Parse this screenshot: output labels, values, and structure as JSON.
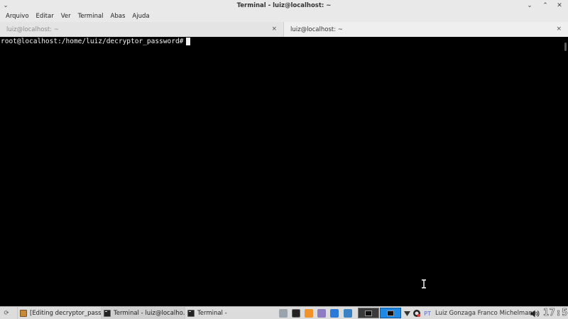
{
  "window": {
    "title": "Terminal - luiz@localhost: ~"
  },
  "menubar": {
    "items": [
      "Arquivo",
      "Editar",
      "Ver",
      "Terminal",
      "Abas",
      "Ajuda"
    ]
  },
  "tabs": [
    {
      "label": "luiz@localhost: ~",
      "active": false
    },
    {
      "label": "luiz@localhost: ~",
      "active": true
    }
  ],
  "terminal": {
    "prompt": "root@localhost:/home/luiz/decryptor_password#"
  },
  "taskbar": {
    "tasks": [
      {
        "label": "[Editing decryptor_pass...",
        "icon": "text-editor-icon"
      },
      {
        "label": "Terminal - luiz@localho...",
        "icon": "terminal-icon"
      },
      {
        "label": "Terminal -",
        "icon": "terminal-icon"
      }
    ],
    "language": "PT",
    "user": "Luiz Gonzaga Franco Michelmann",
    "clock": "17:50"
  },
  "colors": {
    "workspace_active": "#1e88e5",
    "terminal_bg": "#000000",
    "chrome_bg": "#e9e9e9"
  }
}
